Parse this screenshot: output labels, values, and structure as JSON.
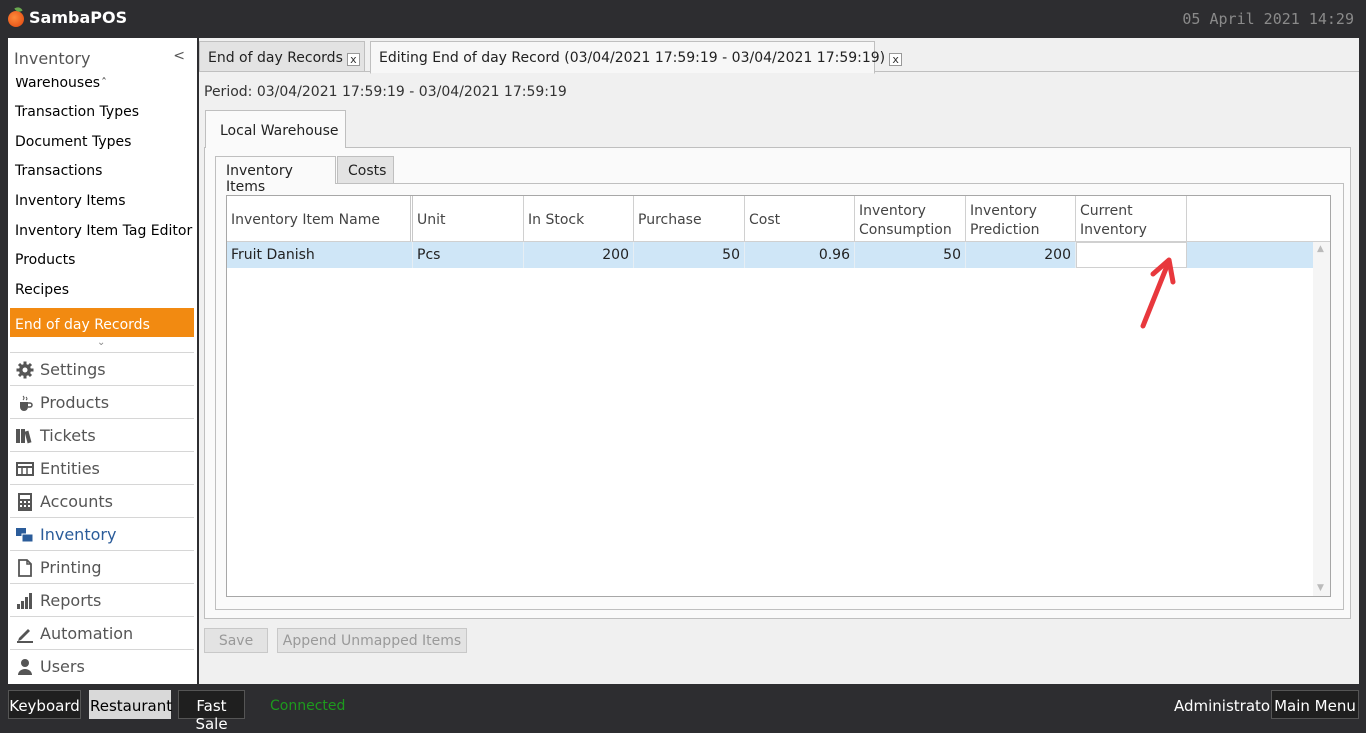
{
  "app": {
    "title": "SambaPOS",
    "datetime": "05 April 2021 14:29"
  },
  "sidebar": {
    "header": "Inventory",
    "collapse_glyph": "<",
    "items": [
      {
        "label": "Warehouses"
      },
      {
        "label": "Transaction Types"
      },
      {
        "label": "Document Types"
      },
      {
        "label": "Transactions"
      },
      {
        "label": "Inventory Items"
      },
      {
        "label": "Inventory Item Tag Editor"
      },
      {
        "label": "Products"
      },
      {
        "label": "Recipes"
      },
      {
        "label": "End of day Records"
      }
    ],
    "menu": [
      {
        "label": "Settings",
        "icon": "gear-icon"
      },
      {
        "label": "Products",
        "icon": "coffee-icon"
      },
      {
        "label": "Tickets",
        "icon": "books-icon"
      },
      {
        "label": "Entities",
        "icon": "table-icon"
      },
      {
        "label": "Accounts",
        "icon": "calculator-icon"
      },
      {
        "label": "Inventory",
        "icon": "boxes-icon"
      },
      {
        "label": "Printing",
        "icon": "document-icon"
      },
      {
        "label": "Reports",
        "icon": "bar-chart-icon"
      },
      {
        "label": "Automation",
        "icon": "pen-icon"
      },
      {
        "label": "Users",
        "icon": "user-icon"
      }
    ]
  },
  "tabs": [
    {
      "label": "End of day Records",
      "close": "x"
    },
    {
      "label": "Editing End of day Record (03/04/2021 17:59:19 - 03/04/2021 17:59:19)",
      "close": "x"
    }
  ],
  "period": "Period: 03/04/2021 17:59:19 - 03/04/2021 17:59:19",
  "warehouse_tab": "Local Warehouse",
  "sub_tabs": [
    "Inventory Items",
    "Costs"
  ],
  "grid": {
    "headers": [
      "Inventory Item Name",
      "Unit",
      "In Stock",
      "Purchase",
      "Cost",
      "Inventory Consumption",
      "Inventory Prediction",
      "Current Inventory"
    ],
    "rows": [
      [
        "Fruit Danish",
        "Pcs",
        "200",
        "50",
        "0.96",
        "50",
        "200",
        ""
      ]
    ]
  },
  "buttons": {
    "save": "Save",
    "append": "Append Unmapped Items"
  },
  "statusbar": {
    "keyboard": "Keyboard",
    "restaurant": "Restaurant",
    "fast_sale": "Fast Sale",
    "connection": "Connected",
    "user": "Administrator",
    "main_menu": "Main Menu"
  },
  "colors": {
    "accent": "#f28a11",
    "row_highlight": "#cfe6f7",
    "annotation_arrow": "#e8383d",
    "connected": "#1d9a1d"
  }
}
